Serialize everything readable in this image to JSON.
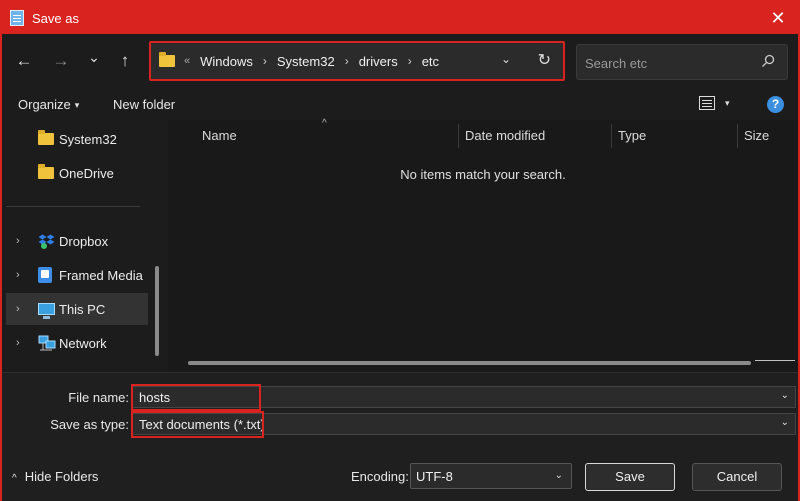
{
  "window": {
    "title": "Save as",
    "close_glyph": "✕"
  },
  "nav": {
    "back_glyph": "←",
    "forward_glyph": "→",
    "recent_glyph": "⌄",
    "up_glyph": "↑"
  },
  "address": {
    "overflow": "«",
    "crumbs": [
      "Windows",
      "System32",
      "drivers",
      "etc"
    ],
    "separator": "›",
    "dropdown_glyph": "⌄",
    "refresh_glyph": "↻"
  },
  "search": {
    "placeholder": "Search etc"
  },
  "toolbar": {
    "organize_label": "Organize",
    "new_folder_label": "New folder",
    "caret": "▾",
    "help_glyph": "?"
  },
  "navpane": {
    "items": [
      {
        "label": "System32",
        "icon": "folder-icon"
      },
      {
        "label": "OneDrive",
        "icon": "folder-icon"
      },
      {
        "label": "Dropbox",
        "icon": "dropbox-icon"
      },
      {
        "label": "Framed Media",
        "icon": "framed-media-icon"
      },
      {
        "label": "This PC",
        "icon": "computer-icon",
        "selected": true
      },
      {
        "label": "Network",
        "icon": "network-icon"
      }
    ],
    "expander": "›"
  },
  "content": {
    "columns": [
      "Name",
      "Date modified",
      "Type",
      "Size"
    ],
    "sort_glyph": "^",
    "empty_message": "No items match your search."
  },
  "form": {
    "file_name_label": "File name:",
    "file_name_value": "hosts",
    "save_type_label": "Save as type:",
    "save_type_value": "Text documents (*.txt)",
    "dropdown_glyph": "⌄",
    "hide_folders_label": "Hide Folders",
    "hide_folders_glyph": "^",
    "encoding_label": "Encoding:",
    "encoding_value": "UTF-8",
    "save_label": "Save",
    "cancel_label": "Cancel"
  },
  "colors": {
    "accent": "#d9231f",
    "background": "#1c1c1c",
    "folder": "#f0c33c",
    "help": "#3b8fe0"
  }
}
